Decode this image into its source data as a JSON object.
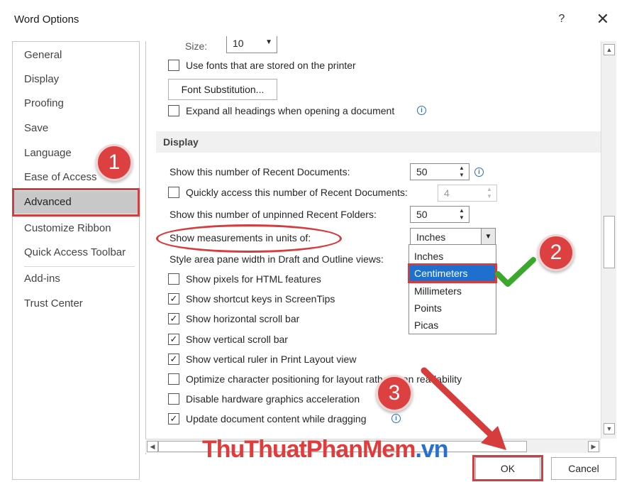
{
  "window": {
    "title": "Word Options",
    "help_glyph": "?",
    "close_glyph": "✕"
  },
  "nav": {
    "items": [
      "General",
      "Display",
      "Proofing",
      "Save",
      "Language",
      "Ease of Access",
      "Advanced",
      "Customize Ribbon",
      "Quick Access Toolbar",
      "Add-ins",
      "Trust Center"
    ],
    "selected": "Advanced"
  },
  "content": {
    "font_size_label": "Size:",
    "font_size_value": "10",
    "use_printer_fonts_label": "Use fonts that are stored on the printer",
    "use_printer_fonts_checked": false,
    "font_substitution_button": "Font Substitution...",
    "expand_headings_label": "Expand all headings when opening a document",
    "expand_headings_checked": false,
    "display_section": "Display",
    "recent_docs_label": "Show this number of Recent Documents:",
    "recent_docs_value": "50",
    "quick_access_label": "Quickly access this number of Recent Documents:",
    "quick_access_checked": false,
    "quick_access_value": "4",
    "unpinned_folders_label": "Show this number of unpinned Recent Folders:",
    "unpinned_folders_value": "50",
    "measurements_label": "Show measurements in units of:",
    "measurements_value": "Inches",
    "style_area_label": "Style area pane width in Draft and Outline views:",
    "checkboxes": [
      {
        "label": "Show pixels for HTML features",
        "checked": false
      },
      {
        "label": "Show shortcut keys in ScreenTips",
        "checked": true
      },
      {
        "label": "Show horizontal scroll bar",
        "checked": true
      },
      {
        "label": "Show vertical scroll bar",
        "checked": true
      },
      {
        "label": "Show vertical ruler in Print Layout view",
        "checked": true
      },
      {
        "label": "Optimize character positioning for layout rather than readability",
        "checked": false
      },
      {
        "label": "Disable hardware graphics acceleration",
        "checked": false
      },
      {
        "label": "Update document content while dragging",
        "checked": true
      }
    ]
  },
  "dropdown": {
    "options": [
      "Inches",
      "Centimeters",
      "Millimeters",
      "Points",
      "Picas"
    ],
    "highlighted": "Centimeters"
  },
  "buttons": {
    "ok": "OK",
    "cancel": "Cancel"
  },
  "annotations": {
    "step1": "1",
    "step2": "2",
    "step3": "3",
    "watermark_part1": "ThuThuat",
    "watermark_part2": "PhanMem",
    "watermark_part3": ".vn",
    "annotation_color": "#d63c3c",
    "check_color": "#3aa82c"
  },
  "colors": {
    "highlight": "#1e6fce",
    "selected_nav": "#c8c8c8",
    "watermark_red": "#e23b3b",
    "watermark_blue": "#2a6fd0"
  }
}
